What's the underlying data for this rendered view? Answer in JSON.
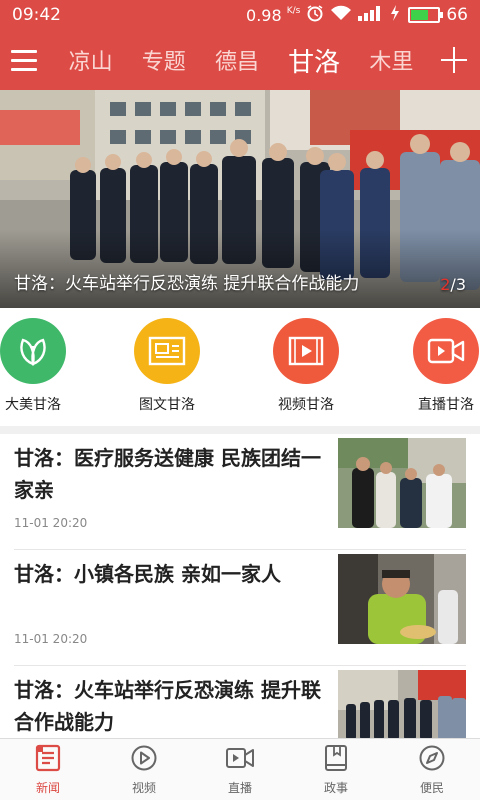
{
  "status": {
    "time": "09:42",
    "speed": "0.98",
    "speed_unit": "K/s",
    "battery": "66"
  },
  "channels": {
    "items": [
      "凉山",
      "专题",
      "德昌",
      "甘洛",
      "木里"
    ],
    "active": "甘洛"
  },
  "banner": {
    "caption": "甘洛：火车站举行反恐演练 提升联合作战能力",
    "page_current": "2",
    "page_total": "/3"
  },
  "quick_links": [
    {
      "label": "大美甘洛",
      "color": "#3fb86a",
      "icon": "leaf-icon"
    },
    {
      "label": "图文甘洛",
      "color": "#f5b316",
      "icon": "image-text-icon"
    },
    {
      "label": "视频甘洛",
      "color": "#f05a3c",
      "icon": "video-icon"
    },
    {
      "label": "直播甘洛",
      "color": "#f25c45",
      "icon": "live-camera-icon"
    }
  ],
  "news": [
    {
      "title": "甘洛：医疗服务送健康 民族团结一家亲",
      "time": "11-01 20:20"
    },
    {
      "title": "甘洛：小镇各民族 亲如一家人",
      "time": "11-01 20:20"
    },
    {
      "title": "甘洛：火车站举行反恐演练 提升联合作战能力",
      "time": ""
    }
  ],
  "bottom_nav": [
    {
      "label": "新闻",
      "icon": "news-icon"
    },
    {
      "label": "视频",
      "icon": "play-icon"
    },
    {
      "label": "直播",
      "icon": "live-icon"
    },
    {
      "label": "政事",
      "icon": "book-icon"
    },
    {
      "label": "便民",
      "icon": "compass-icon"
    }
  ],
  "colors": {
    "brand": "#dc4b45",
    "active_nav": "#dc4b45"
  }
}
